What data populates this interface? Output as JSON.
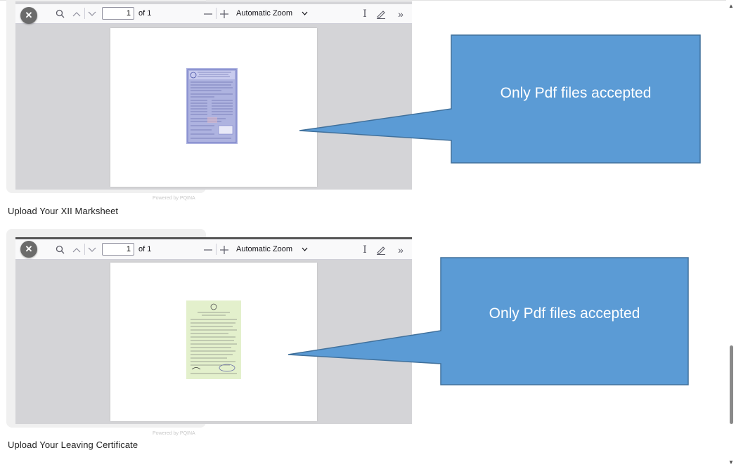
{
  "viewers": [
    {
      "id": "marksheet",
      "page_number": "1",
      "page_of": "of 1",
      "zoom": "Automatic Zoom",
      "powered_by": "Powered by PQINA",
      "upload_label": "Upload Your XII Marksheet",
      "callout_text": "Only Pdf files accepted"
    },
    {
      "id": "leaving-certificate",
      "page_number": "1",
      "page_of": "of 1",
      "zoom": "Automatic Zoom",
      "powered_by": "Powered by PQINA",
      "upload_label": "Upload Your Leaving Certificate",
      "callout_text": "Only Pdf files accepted"
    }
  ],
  "colors": {
    "callout_fill": "#5b9bd5",
    "callout_stroke": "#41719c",
    "viewer_bg": "#d4d4d7",
    "toolbar_bg": "#f9f9fa",
    "doc1_tint": "#9aa0d8",
    "doc2_tint": "#dfeec4"
  },
  "icons": {
    "close": "close-icon",
    "search": "search-icon",
    "prev": "chevron-up-icon",
    "next": "chevron-down-icon",
    "zoom_out": "minus-icon",
    "zoom_in": "plus-icon",
    "dropdown": "chevron-down-icon",
    "text_tool": "text-cursor-icon",
    "draw": "pen-icon",
    "more": "double-chevron-right-icon"
  }
}
